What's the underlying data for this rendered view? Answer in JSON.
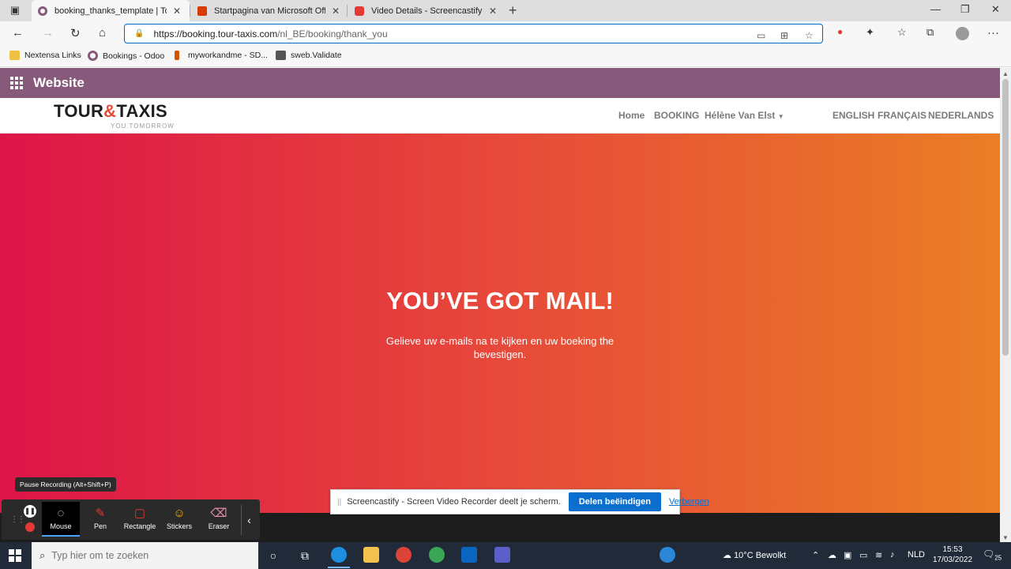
{
  "browser": {
    "tabs": [
      {
        "title": "booking_thanks_template | Tour",
        "color": "#875a7b",
        "active": true
      },
      {
        "title": "Startpagina van Microsoft Office",
        "color": "#d83b01",
        "active": false
      },
      {
        "title": "Video Details - Screencastify",
        "color": "#e53935",
        "active": false
      }
    ],
    "url_host": "https://booking.tour-taxis.com",
    "url_path": "/nl_BE/booking/thank_you",
    "bookmarks": [
      {
        "label": "Nextensa Links",
        "color": "#f0c040"
      },
      {
        "label": "Bookings - Odoo",
        "color": "#875a7b"
      },
      {
        "label": "myworkandme - SD...",
        "color": "#d35400"
      },
      {
        "label": "sweb.Validate",
        "color": "#555555"
      }
    ]
  },
  "odoo": {
    "title": "Website"
  },
  "site": {
    "logo_main_1": "TOUR",
    "logo_amp": "&",
    "logo_main_2": "TAXIS",
    "logo_tag": "YOU.TOMORROW",
    "nav": {
      "home": "Home",
      "booking": "BOOKING",
      "user": "Hélène Van Elst",
      "lang_en": "ENGLISH",
      "lang_fr": "FRANÇAIS",
      "lang_nl": "NEDERLANDS"
    },
    "hero_title": "YOU’VE GOT MAIL!",
    "hero_text": "Gelieve uw e-mails na te kijken en uw boeking the bevestigen."
  },
  "share_bar": {
    "message": "Screencastify - Screen Video Recorder deelt je scherm.",
    "stop_label": "Delen beëindigen",
    "hide_label": "Verbergen"
  },
  "screencastify": {
    "tooltip": "Pause Recording (Alt+Shift+P)",
    "tools": {
      "mouse": "Mouse",
      "pen": "Pen",
      "rectangle": "Rectangle",
      "stickers": "Stickers",
      "eraser": "Eraser"
    }
  },
  "taskbar": {
    "search_placeholder": "Typ hier om te zoeken",
    "weather": "10°C  Bewolkt",
    "language": "NLD",
    "time": "15:53",
    "date": "17/03/2022",
    "notifications": "25"
  }
}
